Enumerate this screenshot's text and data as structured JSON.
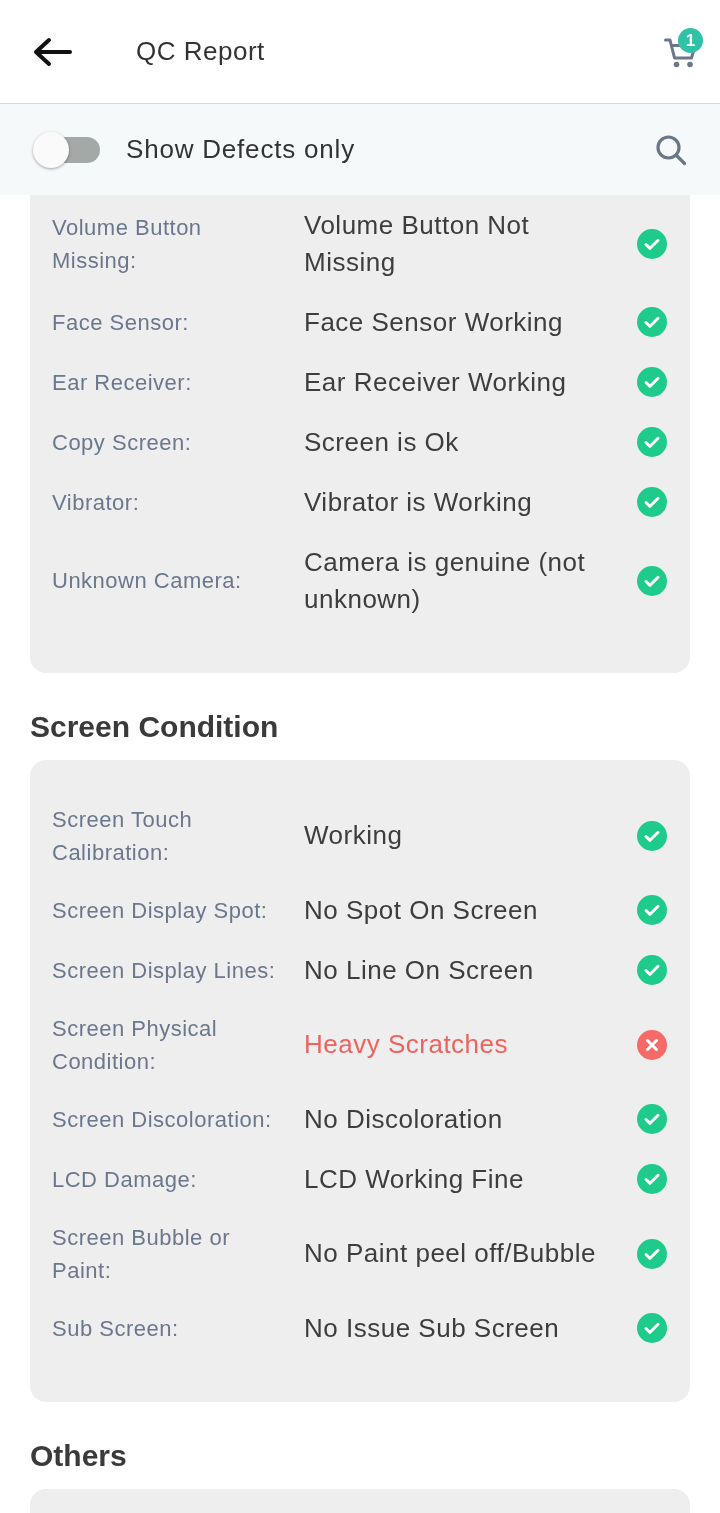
{
  "header": {
    "title": "QC Report",
    "cart_count": "1"
  },
  "filter": {
    "label": "Show Defects only",
    "on": false
  },
  "sections": [
    {
      "rows": [
        {
          "label": "Volume Button Missing:",
          "value": "Volume Button Not Missing",
          "passed": true
        },
        {
          "label": "Face Sensor:",
          "value": "Face Sensor Working",
          "passed": true
        },
        {
          "label": "Ear Receiver:",
          "value": "Ear Receiver Working",
          "passed": true
        },
        {
          "label": "Copy Screen:",
          "value": "Screen is Ok",
          "passed": true
        },
        {
          "label": "Vibrator:",
          "value": "Vibrator is Working",
          "passed": true
        },
        {
          "label": "Unknown Camera:",
          "value": "Camera is genuine (not unknown)",
          "passed": true
        }
      ]
    },
    {
      "title": "Screen Condition",
      "rows": [
        {
          "label": "Screen Touch Calibration:",
          "value": "Working",
          "passed": true
        },
        {
          "label": "Screen Display Spot:",
          "value": "No Spot On Screen",
          "passed": true
        },
        {
          "label": "Screen Display Lines:",
          "value": "No Line On Screen",
          "passed": true
        },
        {
          "label": "Screen Physical Condition:",
          "value": "Heavy Scratches",
          "passed": false
        },
        {
          "label": "Screen Discoloration:",
          "value": "No Discoloration",
          "passed": true
        },
        {
          "label": "LCD Damage:",
          "value": "LCD Working Fine",
          "passed": true
        },
        {
          "label": "Screen Bubble or Paint:",
          "value": "No Paint peel off/Bubble",
          "passed": true
        },
        {
          "label": "Sub Screen:",
          "value": "No Issue Sub Screen",
          "passed": true
        }
      ]
    },
    {
      "title": "Others"
    }
  ]
}
